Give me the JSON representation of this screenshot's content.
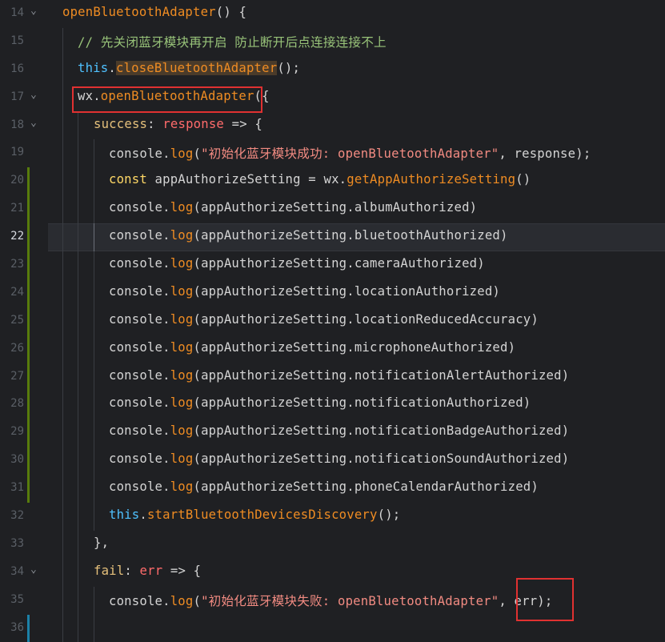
{
  "editor": {
    "lines": [
      {
        "n": "14",
        "fold": true
      },
      {
        "n": "15"
      },
      {
        "n": "16"
      },
      {
        "n": "17",
        "fold": true
      },
      {
        "n": "18",
        "fold": true
      },
      {
        "n": "19"
      },
      {
        "n": "20"
      },
      {
        "n": "21"
      },
      {
        "n": "22"
      },
      {
        "n": "23"
      },
      {
        "n": "24"
      },
      {
        "n": "25"
      },
      {
        "n": "26"
      },
      {
        "n": "27"
      },
      {
        "n": "28"
      },
      {
        "n": "29"
      },
      {
        "n": "30"
      },
      {
        "n": "31"
      },
      {
        "n": "32"
      },
      {
        "n": "33"
      },
      {
        "n": "34",
        "fold": true
      },
      {
        "n": "35"
      },
      {
        "n": "36"
      }
    ],
    "code": {
      "l14": {
        "fn": "openBluetoothAdapter",
        "rest": "() {"
      },
      "l15": {
        "comment": "// 先关闭蓝牙模块再开启 防止断开后点连接连接不上"
      },
      "l16": {
        "kw": "this",
        "dot": ".",
        "fn": "closeBluetoothAdapter",
        "rest": "();"
      },
      "l17": {
        "obj": "wx",
        "dot": ".",
        "fn": "openBluetoothAdapter",
        "rest": "({"
      },
      "l18": {
        "key": "success",
        "colon": ": ",
        "param": "response",
        "arrow": " => {"
      },
      "l19": {
        "obj": "console",
        "dot": ".",
        "fn": "log",
        "open": "(",
        "str": "\"初始化蓝牙模块成功: openBluetoothAdapter\"",
        "rest": ", response);"
      },
      "l20": {
        "kw": "const",
        "name": " appAuthorizeSetting = ",
        "obj": "wx",
        "dot": ".",
        "fn": "getAppAuthorizeSetting",
        "rest": "()"
      },
      "l21": {
        "obj": "console",
        "dot": ".",
        "fn": "log",
        "rest": "(appAuthorizeSetting.albumAuthorized)"
      },
      "l22": {
        "obj": "console",
        "dot": ".",
        "fn": "log",
        "rest": "(appAuthorizeSetting.bluetoothAuthorized)"
      },
      "l23": {
        "obj": "console",
        "dot": ".",
        "fn": "log",
        "rest": "(appAuthorizeSetting.cameraAuthorized)"
      },
      "l24": {
        "obj": "console",
        "dot": ".",
        "fn": "log",
        "rest": "(appAuthorizeSetting.locationAuthorized)"
      },
      "l25": {
        "obj": "console",
        "dot": ".",
        "fn": "log",
        "rest": "(appAuthorizeSetting.locationReducedAccuracy)"
      },
      "l26": {
        "obj": "console",
        "dot": ".",
        "fn": "log",
        "rest": "(appAuthorizeSetting.microphoneAuthorized)"
      },
      "l27": {
        "obj": "console",
        "dot": ".",
        "fn": "log",
        "rest": "(appAuthorizeSetting.notificationAlertAuthorized)"
      },
      "l28": {
        "obj": "console",
        "dot": ".",
        "fn": "log",
        "rest": "(appAuthorizeSetting.notificationAuthorized)"
      },
      "l29": {
        "obj": "console",
        "dot": ".",
        "fn": "log",
        "rest": "(appAuthorizeSetting.notificationBadgeAuthorized)"
      },
      "l30": {
        "obj": "console",
        "dot": ".",
        "fn": "log",
        "rest": "(appAuthorizeSetting.notificationSoundAuthorized)"
      },
      "l31": {
        "obj": "console",
        "dot": ".",
        "fn": "log",
        "rest": "(appAuthorizeSetting.phoneCalendarAuthorized)"
      },
      "l32": {
        "kw": "this",
        "dot": ".",
        "fn": "startBluetoothDevicesDiscovery",
        "rest": "();"
      },
      "l33": {
        "rest": "},"
      },
      "l34": {
        "key": "fail",
        "colon": ": ",
        "param": "err",
        "arrow": " => {"
      },
      "l35": {
        "obj": "console",
        "dot": ".",
        "fn": "log",
        "open": "(",
        "str": "\"初始化蓝牙模块失败: openBluetoothAdapter\"",
        "comma": ", ",
        "errarg": "err",
        "rest": ");"
      }
    }
  }
}
